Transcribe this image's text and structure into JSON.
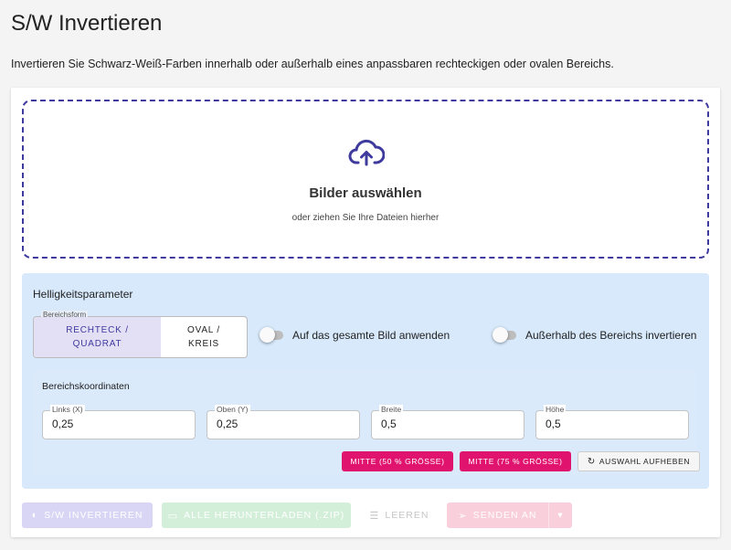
{
  "header": {
    "title": "S/W Invertieren",
    "description": "Invertieren Sie Schwarz-Weiß-Farben innerhalb oder außerhalb eines anpassbaren rechteckigen oder ovalen Bereichs."
  },
  "dropzone": {
    "icon": "cloud-upload-icon",
    "title": "Bilder auswählen",
    "subtitle": "oder ziehen Sie Ihre Dateien hierher"
  },
  "params": {
    "title": "Helligkeitsparameter",
    "shape_legend": "Bereichsform",
    "shape_rect": "RECHTECK / QUADRAT",
    "shape_oval": "OVAL / KREIS",
    "toggle_whole": "Auf das gesamte Bild anwenden",
    "toggle_outside": "Außerhalb des Bereichs invertieren"
  },
  "coords": {
    "title": "Bereichskoordinaten",
    "left_label": "Links (X)",
    "left_value": "0,25",
    "top_label": "Oben (Y)",
    "top_value": "0,25",
    "width_label": "Breite",
    "width_value": "0,5",
    "height_label": "Höhe",
    "height_value": "0,5",
    "center50": "MITTE (50 % GRÖSSE)",
    "center75": "MITTE (75 % GRÖSSE)",
    "clear_selection": "AUSWAHL AUFHEBEN"
  },
  "actions": {
    "invert": "S/W INVERTIEREN",
    "download_all": "ALLE HERUNTERLADEN (.ZIP)",
    "clear": "LEEREN",
    "send_to": "SENDEN AN"
  },
  "colors": {
    "accent": "#3f3a9e",
    "pink": "#e0146f",
    "panel": "#d7e9fb"
  }
}
